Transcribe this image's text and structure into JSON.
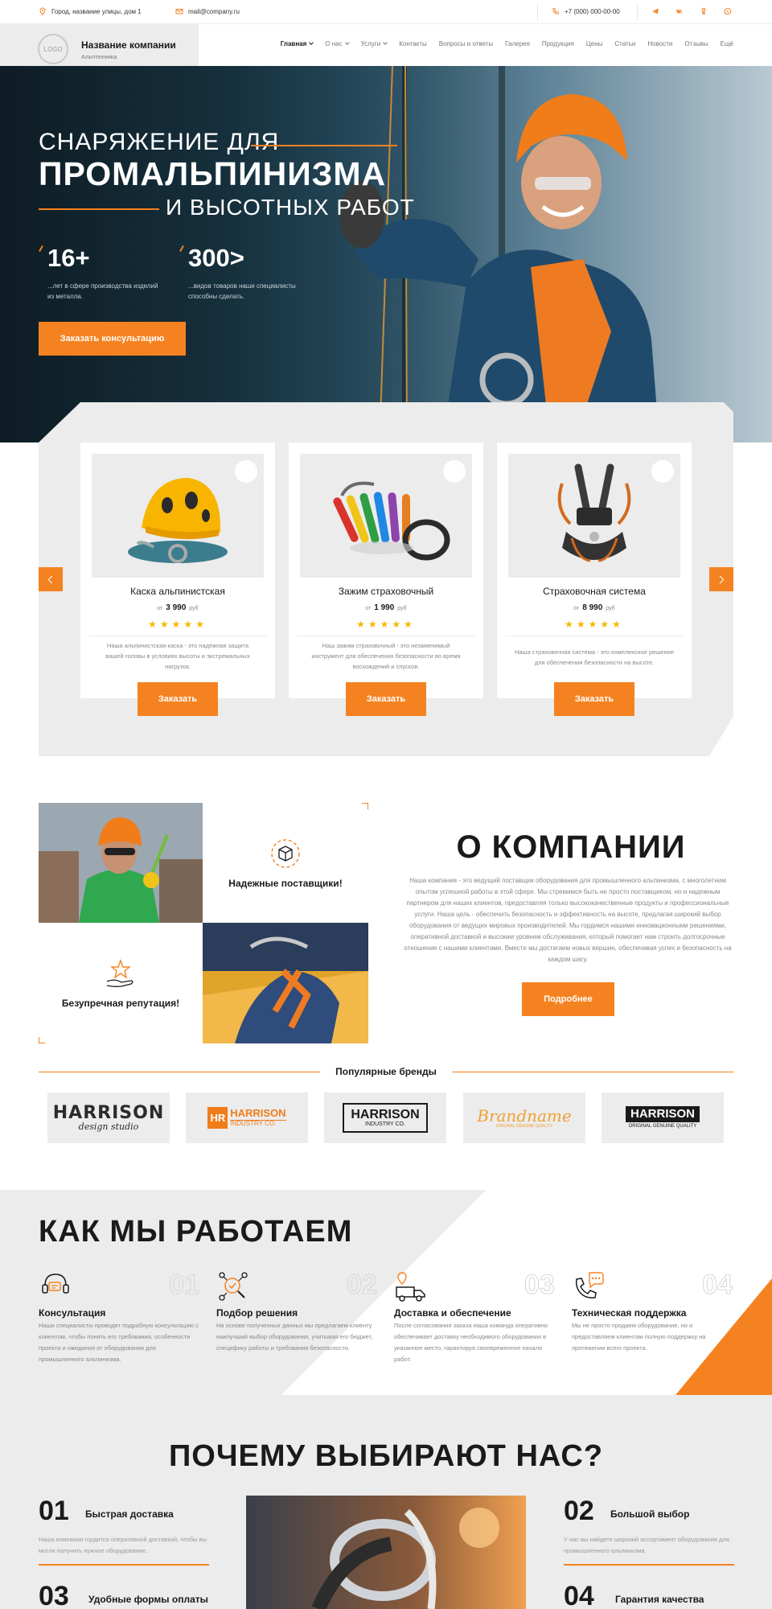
{
  "topbar": {
    "address": "Город, название улицы, дом 1",
    "email": "mail@company.ru",
    "phone": "+7 (000) 000-00-00",
    "socials": [
      "telegram-icon",
      "vk-icon",
      "ok-icon",
      "whatsapp-icon"
    ]
  },
  "header": {
    "logo": "LOGO",
    "company_name": "Название компании",
    "company_sub": "Альптехника",
    "nav": [
      "Главная",
      "О нас",
      "Услуги",
      "Контакты",
      "Вопросы и ответы",
      "Галерея",
      "Продукция",
      "Цены",
      "Статьи",
      "Новости",
      "Отзывы",
      "Ещё"
    ]
  },
  "hero": {
    "line1": "СНАРЯЖЕНИЕ ДЛЯ",
    "line2": "ПРОМАЛЬПИНИЗМА",
    "line3": "И ВЫСОТНЫХ РАБОТ",
    "stat1_num": "16+",
    "stat1_desc": "...лет в сфере производства изделий из металла.",
    "stat2_num": "300>",
    "stat2_desc": "...видов товаров наши специалисты способны сделать.",
    "button": "Заказать консультацию"
  },
  "products": [
    {
      "title": "Каска альпинистская",
      "price_prefix": "от",
      "price": "3 990",
      "currency": "руб",
      "stars": "★★★★★",
      "desc": "Наша альпинистская каска - это надежная защита вашей головы в условиях высоты и экстремальных нагрузок.",
      "button": "Заказать"
    },
    {
      "title": "Зажим страховочный",
      "price_prefix": "от",
      "price": "1 990",
      "currency": "руб",
      "stars": "★★★★★",
      "desc": "Наш зажим страховочный - это незаменимый инструмент для обеспечения безопасности во время восхождений и спусков.",
      "button": "Заказать"
    },
    {
      "title": "Страховочная система",
      "price_prefix": "от",
      "price": "8 990",
      "currency": "руб",
      "stars": "★★★★★",
      "desc": "Наша страховочная система - это комплексное решение для обеспечения безопасности на высоте.",
      "button": "Заказать"
    }
  ],
  "about": {
    "feature1": "Надежные поставщики!",
    "feature2": "Безупречная репутация!",
    "title": "О КОМПАНИИ",
    "text": "Наша компания - это ведущий поставщик оборудования для промышленного альпинизма, с многолетним опытом успешной работы в этой сфере. Мы стремимся быть не просто поставщиком, но и надежным партнером для наших клиентов, предоставляя только высококачественные продукты и профессиональные услуги. Наша цель - обеспечить безопасность и эффективность на высоте, предлагая широкий выбор оборудования от ведущих мировых производителей. Мы гордимся нашими инновационными решениями, оперативной доставкой и высоким уровнем обслуживания, который помогает нам строить долгосрочные отношения с нашими клиентами. Вместе мы достигаем новых вершин, обеспечивая успех и безопасность на каждом шагу.",
    "button": "Подробнее"
  },
  "brands": {
    "title": "Популярные бренды",
    "items": [
      {
        "main": "HARRISON",
        "sub": "design studio"
      },
      {
        "main": "HARRISON",
        "sub": "INDUSTRY CO.",
        "badge": "HR"
      },
      {
        "main": "HARRISON",
        "sub": "INDUSTRY CO."
      },
      {
        "main": "Brandname",
        "sub": "ORIGINAL GENUINE QUALITY"
      },
      {
        "main": "HARRISON",
        "sub": "ORIGINAL GENUINE QUALITY"
      }
    ]
  },
  "how": {
    "title": "КАК МЫ РАБОТАЕМ",
    "steps": [
      {
        "num": "01",
        "title": "Консультация",
        "desc": "Наши специалисты проводят подробную консультацию с клиентом, чтобы понять его требования, особенности проекта и ожидания от оборудования для промышленного альпинизма."
      },
      {
        "num": "02",
        "title": "Подбор решения",
        "desc": "На основе полученных данных мы предлагаем клиенту наилучший выбор оборудования, учитывая его бюджет, специфику работы и требования безопасности."
      },
      {
        "num": "03",
        "title": "Доставка и обеспечение",
        "desc": "После согласования заказа наша команда оперативно обеспечивает доставку необходимого оборудования в указанное место, гарантируя своевременное начало работ."
      },
      {
        "num": "04",
        "title": "Техническая поддержка",
        "desc": "Мы не просто продаем оборудование, но и предоставляем клиентам полную поддержку на протяжении всего проекта."
      }
    ]
  },
  "why": {
    "title": "ПОЧЕМУ ВЫБИРАЮТ НАС?",
    "items": [
      {
        "num": "01",
        "title": "Быстрая доставка",
        "desc": "Наша компания гордится оперативной доставкой, чтобы вы могли получить нужное оборудование."
      },
      {
        "num": "02",
        "title": "Большой выбор",
        "desc": "У нас вы найдете широкий ассортимент оборудования для промышленного альпинизма."
      },
      {
        "num": "03",
        "title": "Удобные формы оплаты",
        "desc": ""
      },
      {
        "num": "04",
        "title": "Гарантия качества",
        "desc": ""
      }
    ]
  },
  "colors": {
    "accent": "#f58220",
    "light_bg": "#ececec",
    "dark_text": "#1a1a1a",
    "star": "#f5b800"
  }
}
